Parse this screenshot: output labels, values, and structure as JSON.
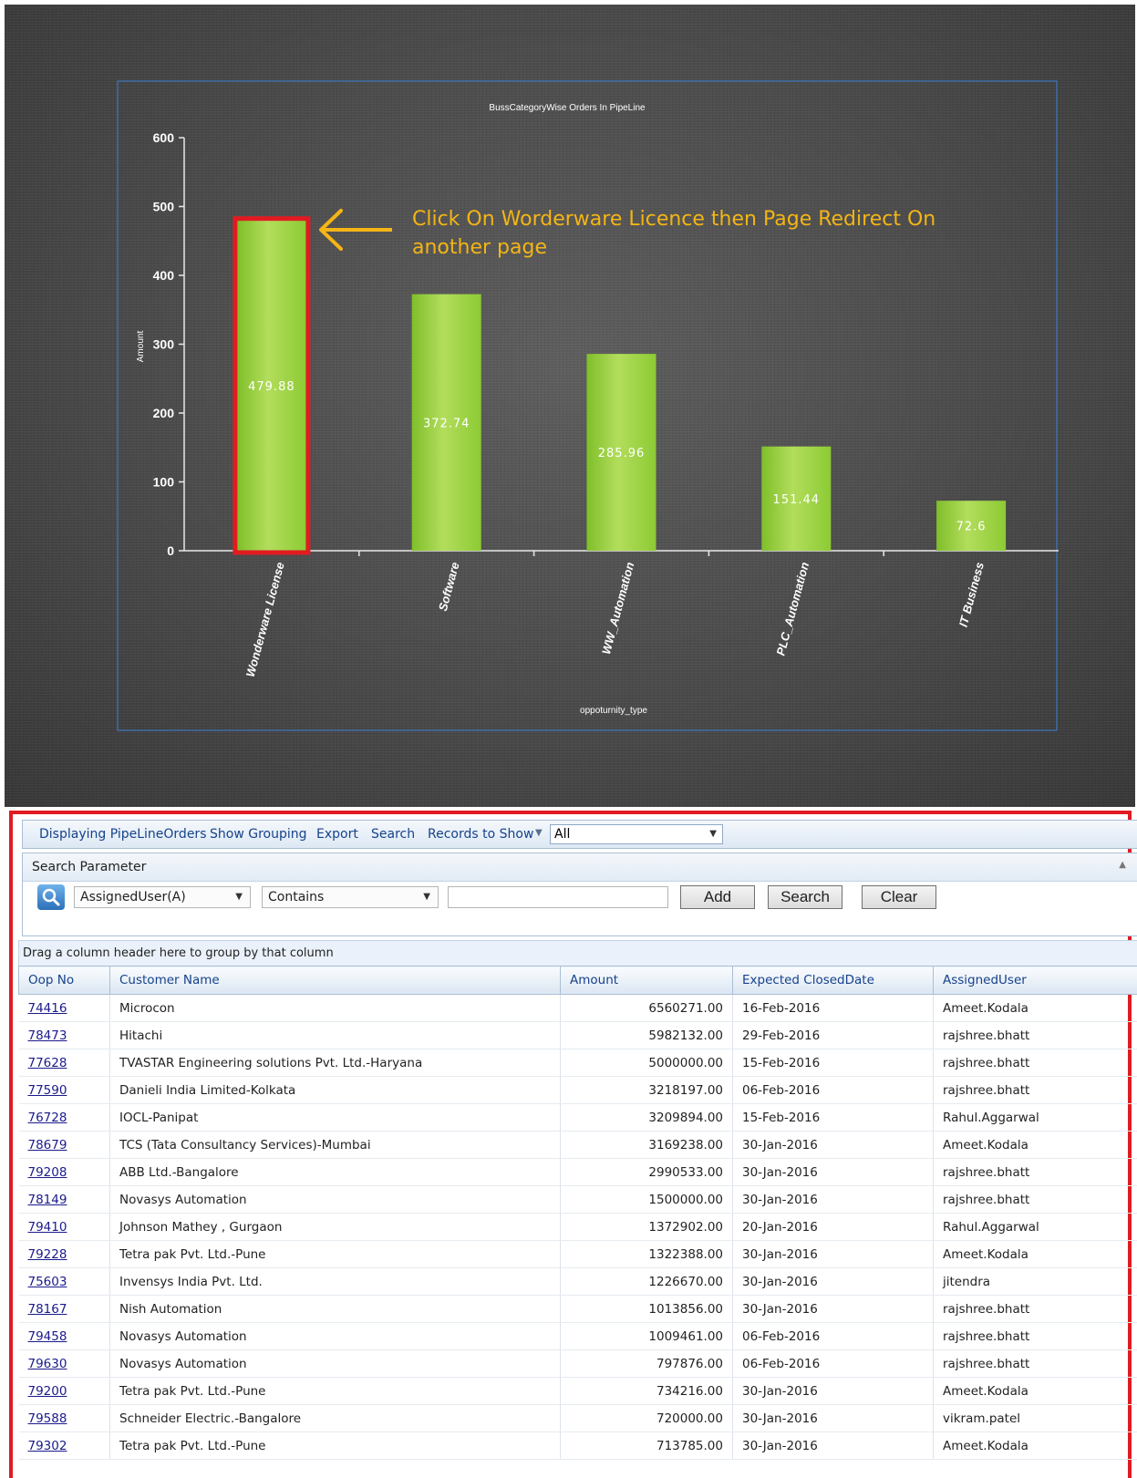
{
  "chart_data": {
    "type": "bar",
    "title": "BussCategoryWise Orders In PipeLine",
    "xlabel": "oppoturnity_type",
    "ylabel": "Amount",
    "categories": [
      "Wonderware License",
      "Software",
      "WW_Automation",
      "PLC_Automation",
      "IT Business"
    ],
    "values": [
      479.88,
      372.74,
      285.96,
      151.44,
      72.6
    ],
    "value_labels": [
      "479.88",
      "372.74",
      "285.96",
      "151.44",
      "72.6"
    ],
    "ylim": [
      0,
      600
    ],
    "yticks": [
      0,
      100,
      200,
      300,
      400,
      500,
      600
    ],
    "grid": false,
    "bar_color": "#9bd045",
    "highlight_color": "#e11b22",
    "annotation": {
      "line1": "Click On Worderware Licence then Page Redirect On",
      "line2": "another page",
      "color": "#f4b515"
    }
  },
  "toolbar": {
    "displaying": "Displaying PipeLineOrders",
    "show_grouping": "Show Grouping",
    "export": "Export",
    "search": "Search",
    "records_to_show": "Records to Show",
    "records_value": "All"
  },
  "search_panel": {
    "title": "Search Parameter",
    "field": "AssignedUser(A)",
    "operator": "Contains",
    "value": "",
    "add_label": "Add",
    "search_label": "Search",
    "clear_label": "Clear"
  },
  "group_hint": "Drag a column header here to group by that column",
  "table": {
    "columns": [
      "Oop No",
      "Customer Name",
      "Amount",
      "Expected ClosedDate",
      "AssignedUser"
    ],
    "rows": [
      [
        "74416",
        "Microcon",
        "6560271.00",
        "16-Feb-2016",
        "Ameet.Kodala"
      ],
      [
        "78473",
        "Hitachi",
        "5982132.00",
        "29-Feb-2016",
        "rajshree.bhatt"
      ],
      [
        "77628",
        "TVASTAR Engineering solutions Pvt. Ltd.-Haryana",
        "5000000.00",
        "15-Feb-2016",
        "rajshree.bhatt"
      ],
      [
        "77590",
        "Danieli India Limited-Kolkata",
        "3218197.00",
        "06-Feb-2016",
        "rajshree.bhatt"
      ],
      [
        "76728",
        "IOCL-Panipat",
        "3209894.00",
        "15-Feb-2016",
        "Rahul.Aggarwal"
      ],
      [
        "78679",
        "TCS (Tata Consultancy Services)-Mumbai",
        "3169238.00",
        "30-Jan-2016",
        "Ameet.Kodala"
      ],
      [
        "79208",
        "ABB Ltd.-Bangalore",
        "2990533.00",
        "30-Jan-2016",
        "rajshree.bhatt"
      ],
      [
        "78149",
        "Novasys Automation",
        "1500000.00",
        "30-Jan-2016",
        "rajshree.bhatt"
      ],
      [
        "79410",
        "Johnson Mathey , Gurgaon",
        "1372902.00",
        "20-Jan-2016",
        "Rahul.Aggarwal"
      ],
      [
        "79228",
        "Tetra pak Pvt. Ltd.-Pune",
        "1322388.00",
        "30-Jan-2016",
        "Ameet.Kodala"
      ],
      [
        "75603",
        "Invensys India Pvt. Ltd.",
        "1226670.00",
        "30-Jan-2016",
        "jitendra"
      ],
      [
        "78167",
        "Nish Automation",
        "1013856.00",
        "30-Jan-2016",
        "rajshree.bhatt"
      ],
      [
        "79458",
        "Novasys Automation",
        "1009461.00",
        "06-Feb-2016",
        "rajshree.bhatt"
      ],
      [
        "79630",
        "Novasys Automation",
        "797876.00",
        "06-Feb-2016",
        "rajshree.bhatt"
      ],
      [
        "79200",
        "Tetra pak Pvt. Ltd.-Pune",
        "734216.00",
        "30-Jan-2016",
        "Ameet.Kodala"
      ],
      [
        "79588",
        "Schneider Electric.-Bangalore",
        "720000.00",
        "30-Jan-2016",
        "vikram.patel"
      ],
      [
        "79302",
        "Tetra pak Pvt. Ltd.-Pune",
        "713785.00",
        "30-Jan-2016",
        "Ameet.Kodala"
      ]
    ]
  }
}
